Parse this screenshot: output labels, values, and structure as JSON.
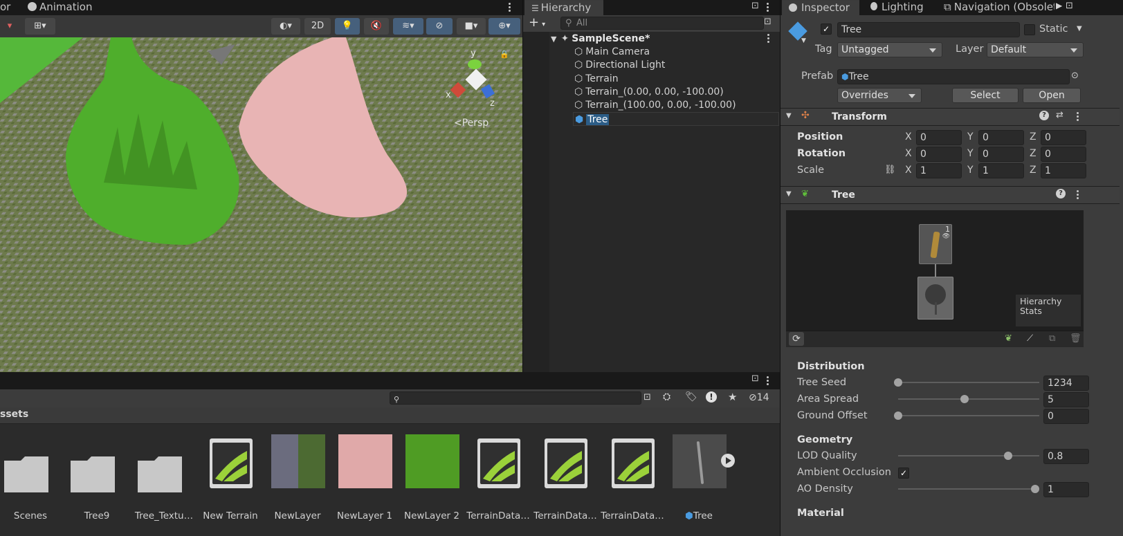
{
  "scene_view": {
    "tabs": [
      "or",
      "Animation"
    ],
    "toolbar": {
      "mode_2d": "2D"
    },
    "gizmo": {
      "y": "y",
      "x": "x",
      "z": "z",
      "persp": "Persp"
    }
  },
  "hierarchy": {
    "tab": "Hierarchy",
    "search_placeholder": "All",
    "scene_name": "SampleScene*",
    "items": [
      "Main Camera",
      "Directional Light",
      "Terrain",
      "Terrain_(0.00, 0.00, -100.00)",
      "Terrain_(100.00, 0.00, -100.00)",
      "Tree"
    ],
    "selected": "Tree"
  },
  "project": {
    "breadcrumb": "ssets",
    "hidden_count": "14",
    "assets": [
      {
        "label": "Scenes",
        "kind": "folder"
      },
      {
        "label": "Tree9",
        "kind": "folder"
      },
      {
        "label": "Tree_Textu…",
        "kind": "folder"
      },
      {
        "label": "New Terrain",
        "kind": "terrain"
      },
      {
        "label": "NewLayer",
        "kind": "layer"
      },
      {
        "label": "NewLayer 1",
        "kind": "layer"
      },
      {
        "label": "NewLayer 2",
        "kind": "layer"
      },
      {
        "label": "TerrainData…",
        "kind": "terrain"
      },
      {
        "label": "TerrainData…",
        "kind": "terrain"
      },
      {
        "label": "TerrainData…",
        "kind": "terrain"
      },
      {
        "label": "Tree",
        "kind": "prefab"
      }
    ]
  },
  "inspector": {
    "tabs": [
      "Inspector",
      "Lighting",
      "Navigation (Obsolete"
    ],
    "object_name": "Tree",
    "static_label": "Static",
    "tag_label": "Tag",
    "tag_value": "Untagged",
    "layer_label": "Layer",
    "layer_value": "Default",
    "prefab_label": "Prefab",
    "prefab_value": "Tree",
    "overrides": "Overrides",
    "select_button": "Select",
    "open_button": "Open",
    "transform": {
      "title": "Transform",
      "position": {
        "label": "Position",
        "x": "0",
        "y": "0",
        "z": "0"
      },
      "rotation": {
        "label": "Rotation",
        "x": "0",
        "y": "0",
        "z": "0"
      },
      "scale": {
        "label": "Scale",
        "x": "1",
        "y": "1",
        "z": "1"
      },
      "axis_x": "X",
      "axis_y": "Y",
      "axis_z": "Z"
    },
    "tree": {
      "title": "Tree",
      "node_badge": "1",
      "hierarchy_stats": "Hierarchy Stats",
      "distribution": {
        "title": "Distribution",
        "tree_seed": {
          "label": "Tree Seed",
          "value": "1234",
          "fraction": 0.0
        },
        "area_spread": {
          "label": "Area Spread",
          "value": "5",
          "fraction": 0.47
        },
        "ground_offset": {
          "label": "Ground Offset",
          "value": "0",
          "fraction": 0.0
        }
      },
      "geometry": {
        "title": "Geometry",
        "lod_quality": {
          "label": "LOD Quality",
          "value": "0.8",
          "fraction": 0.78
        },
        "ambient_occlusion": {
          "label": "Ambient Occlusion",
          "checked": true
        },
        "ao_density": {
          "label": "AO Density",
          "value": "1",
          "fraction": 0.97
        }
      },
      "material_title": "Material"
    }
  },
  "colors": {
    "panel": "#282828",
    "toolbar": "#383838",
    "selection": "#2c5d87",
    "accent_blue": "#4a9be0",
    "terrain_green": "#55b83a",
    "terrain_pink": "#e8b4b4"
  }
}
